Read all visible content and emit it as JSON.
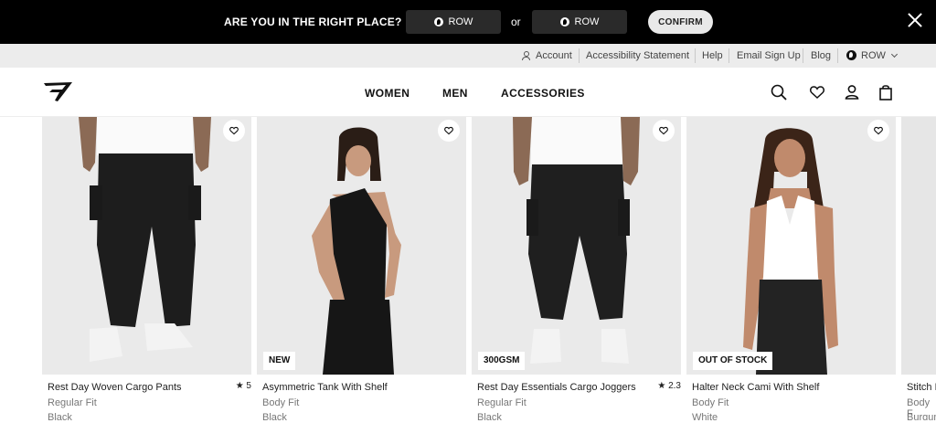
{
  "banner": {
    "question": "ARE YOU IN THE RIGHT PLACE?",
    "region_a": "ROW",
    "or_text": "or",
    "region_b": "ROW",
    "confirm": "CONFIRM"
  },
  "utility": {
    "account": "Account",
    "accessibility": "Accessibility Statement",
    "help": "Help",
    "email_signup": "Email Sign Up",
    "blog": "Blog",
    "region": "ROW"
  },
  "nav": {
    "women": "WOMEN",
    "men": "MEN",
    "accessories": "ACCESSORIES"
  },
  "products": [
    {
      "name": "Rest Day Woven Cargo Pants",
      "fit": "Regular Fit",
      "color": "Black",
      "rating": "★ 5",
      "badge": ""
    },
    {
      "name": "Asymmetric Tank With Shelf",
      "fit": "Body Fit",
      "color": "Black",
      "rating": "",
      "badge": "NEW"
    },
    {
      "name": "Rest Day Essentials Cargo Joggers",
      "fit": "Regular Fit",
      "color": "Black",
      "rating": "★ 2.3",
      "badge": "300GSM"
    },
    {
      "name": "Halter Neck Cami With Shelf",
      "fit": "Body Fit",
      "color": "White",
      "rating": "",
      "badge": "OUT OF STOCK"
    },
    {
      "name": "Stitch F",
      "fit": "Body F",
      "color": "Burgun",
      "rating": "",
      "badge": ""
    }
  ],
  "colors": {
    "banner_bg": "#000000",
    "utility_bg": "#ececec",
    "photo_bg": "#ececec"
  }
}
